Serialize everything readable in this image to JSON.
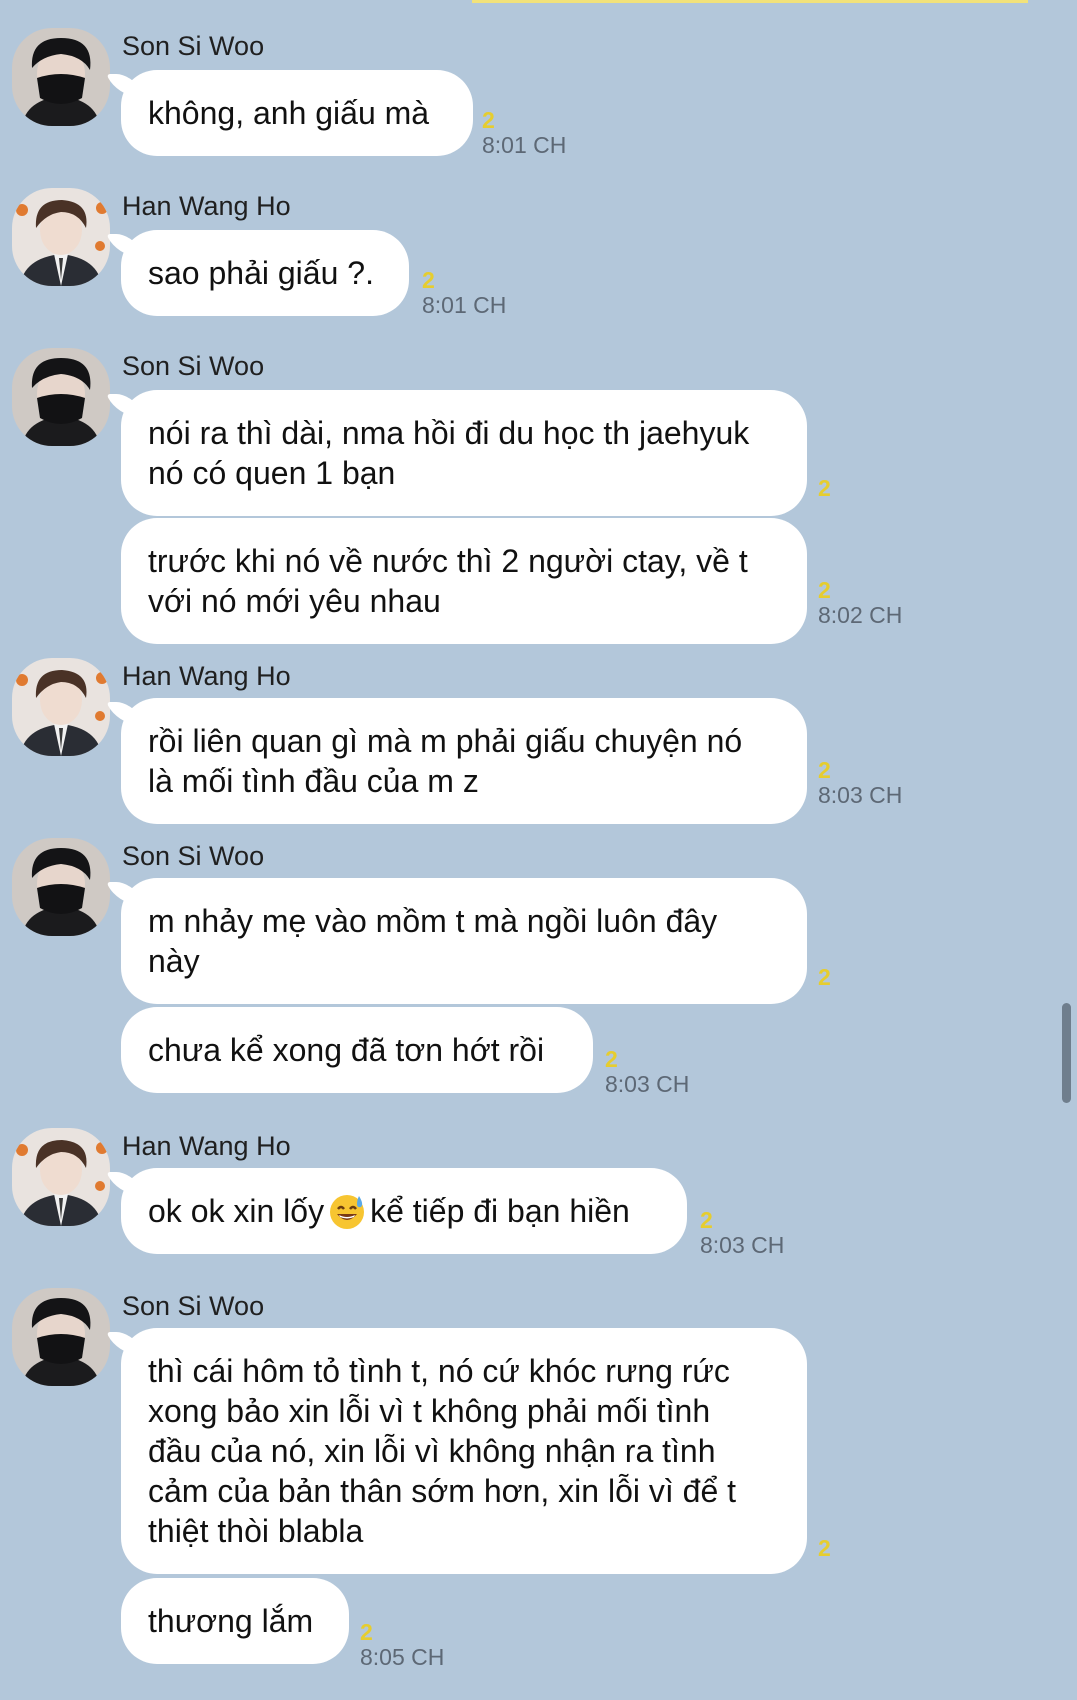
{
  "chat": {
    "users": {
      "son": {
        "name": "Son Si Woo",
        "avatar_icon": "masked-person-avatar-icon"
      },
      "han": {
        "name": "Han Wang Ho",
        "avatar_icon": "suited-person-avatar-icon"
      }
    },
    "groups": [
      {
        "sender": "Son Si Woo",
        "messages": [
          {
            "text": "không, anh giấu mà",
            "read": "2",
            "time": "8:01 CH"
          }
        ]
      },
      {
        "sender": "Han Wang Ho",
        "messages": [
          {
            "text": "sao phải giấu ?.",
            "read": "2",
            "time": "8:01 CH"
          }
        ]
      },
      {
        "sender": "Son Si Woo",
        "messages": [
          {
            "text": "nói ra thì dài, nma hồi đi du học th jaehyuk\nnó có quen 1 bạn",
            "read": "2",
            "time": ""
          },
          {
            "text": " trước khi nó về nước thì 2 người ctay, về t\nvới nó mới yêu nhau",
            "read": "2",
            "time": "8:02 CH"
          }
        ]
      },
      {
        "sender": "Han Wang Ho",
        "messages": [
          {
            "text": "rồi liên quan gì mà m phải giấu chuyện nó\nlà mối tình đầu của m z",
            "read": "2",
            "time": "8:03 CH"
          }
        ]
      },
      {
        "sender": "Son Si Woo",
        "messages": [
          {
            "text": "m nhảy mẹ vào mồm t mà ngồi luôn đây\nnày",
            "read": "2",
            "time": ""
          },
          {
            "text": "chưa kể xong đã tơn hớt rồi",
            "read": "2",
            "time": "8:03 CH"
          }
        ]
      },
      {
        "sender": "Han Wang Ho",
        "messages": [
          {
            "text_before": "ok ok xin lốy",
            "emoji": "sweat-smile-emoji-icon",
            "text_after": "kể tiếp đi bạn hiền",
            "read": "2",
            "time": "8:03 CH"
          }
        ]
      },
      {
        "sender": "Son Si Woo",
        "messages": [
          {
            "text": "thì cái hôm tỏ tình t, nó cứ khóc rưng rức\nxong bảo xin lỗi vì t không phải mối tình\nđầu của nó, xin lỗi vì không nhận ra tình\ncảm của bản thân sớm hơn, xin lỗi vì để t\nthiệt thòi blabla",
            "read": "2",
            "time": ""
          },
          {
            "text": "thương lắm",
            "read": "2",
            "time": "8:05 CH"
          }
        ]
      }
    ]
  },
  "colors": {
    "background": "#b3c7da",
    "bubble": "#ffffff",
    "read_count": "#e6cd2e",
    "time": "#5d6875"
  }
}
